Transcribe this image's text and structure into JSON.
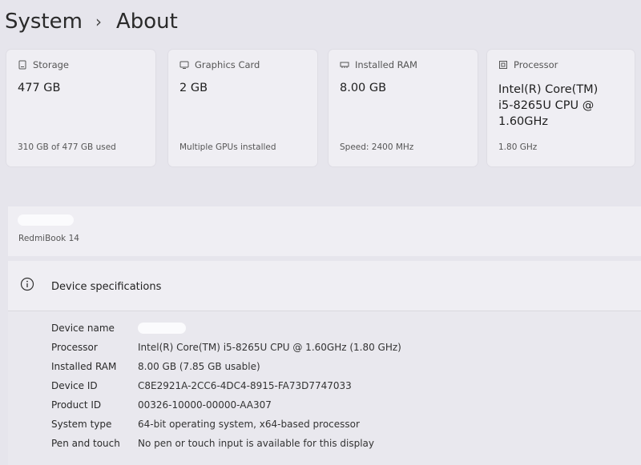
{
  "breadcrumb": {
    "parent": "System",
    "separator": "›",
    "current": "About"
  },
  "cards": [
    {
      "title": "Storage",
      "icon": "storage-icon",
      "value": "477 GB",
      "sub": "310 GB of 477 GB used"
    },
    {
      "title": "Graphics Card",
      "icon": "graphics-card-icon",
      "value": "2 GB",
      "sub": "Multiple GPUs installed"
    },
    {
      "title": "Installed RAM",
      "icon": "ram-icon",
      "value": "8.00 GB",
      "sub": "Speed: 2400 MHz"
    },
    {
      "title": "Processor",
      "icon": "processor-icon",
      "value_lines": [
        "Intel(R) Core(TM)",
        "i5-8265U CPU @",
        "1.60GHz"
      ],
      "sub": "1.80 GHz"
    }
  ],
  "device": {
    "model": "RedmiBook 14"
  },
  "specs": {
    "title": "Device specifications",
    "icon": "info-icon",
    "rows": [
      {
        "label": "Device name",
        "value": ""
      },
      {
        "label": "Processor",
        "value": "Intel(R) Core(TM) i5-8265U CPU @ 1.60GHz (1.80 GHz)"
      },
      {
        "label": "Installed RAM",
        "value": "8.00 GB (7.85 GB usable)"
      },
      {
        "label": "Device ID",
        "value": "C8E2921A-2CC6-4DC4-8915-FA73D7747033"
      },
      {
        "label": "Product ID",
        "value": "00326-10000-00000-AA307"
      },
      {
        "label": "System type",
        "value": "64-bit operating system, x64-based processor"
      },
      {
        "label": "Pen and touch",
        "value": "No pen or touch input is available for this display"
      }
    ]
  }
}
